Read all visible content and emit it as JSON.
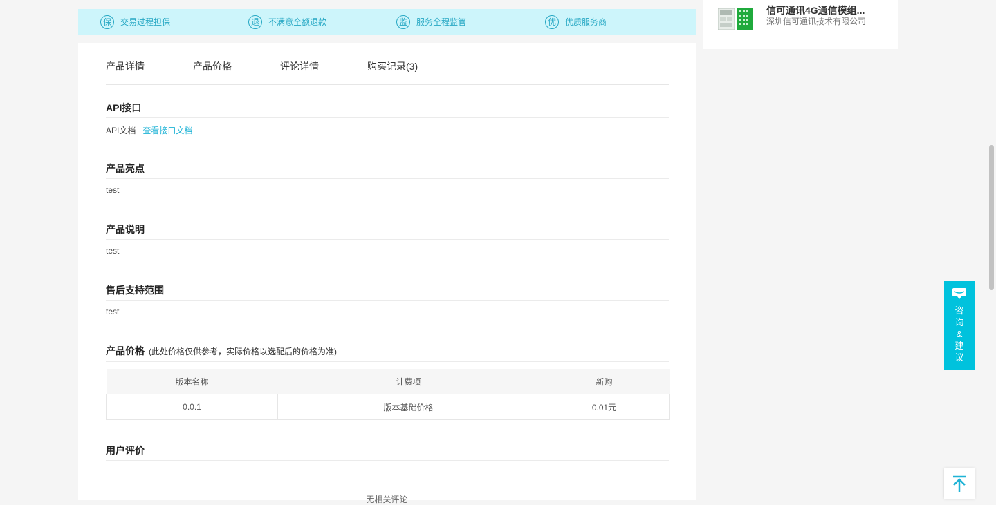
{
  "guarantees": [
    {
      "icon": "保",
      "label": "交易过程担保"
    },
    {
      "icon": "退",
      "label": "不满意全额退款"
    },
    {
      "icon": "监",
      "label": "服务全程监管"
    },
    {
      "icon": "优",
      "label": "优质服务商"
    }
  ],
  "tabs": [
    "产品详情",
    "产品价格",
    "评论详情",
    "购买记录(3)"
  ],
  "api": {
    "title": "API接口",
    "doc_label": "API文档",
    "doc_link": "查看接口文档"
  },
  "highlights": {
    "title": "产品亮点",
    "text": "test"
  },
  "description": {
    "title": "产品说明",
    "text": "test"
  },
  "after_sales": {
    "title": "售后支持范围",
    "text": "test"
  },
  "pricing": {
    "title": "产品价格",
    "note": "(此处价格仅供参考，实际价格以选配后的价格为准)",
    "headers": [
      "版本名称",
      "计费项",
      "新购"
    ],
    "rows": [
      [
        "0.0.1",
        "版本基础价格",
        "0.01元"
      ]
    ]
  },
  "reviews": {
    "title": "用户评价",
    "empty_text": "无相关评论"
  },
  "side_product": {
    "name": "信可通讯4G通信模组...",
    "company": "深圳信可通讯技术有限公司"
  },
  "consult": {
    "label": "咨询&建议",
    "chars": [
      "咨",
      "询",
      "&",
      "建",
      "议"
    ]
  },
  "colors": {
    "accent": "#00c2dd",
    "guarantee_bg": "#cdf5fb",
    "guarantee_text": "#27a8c4",
    "link": "#1fb3d6"
  }
}
